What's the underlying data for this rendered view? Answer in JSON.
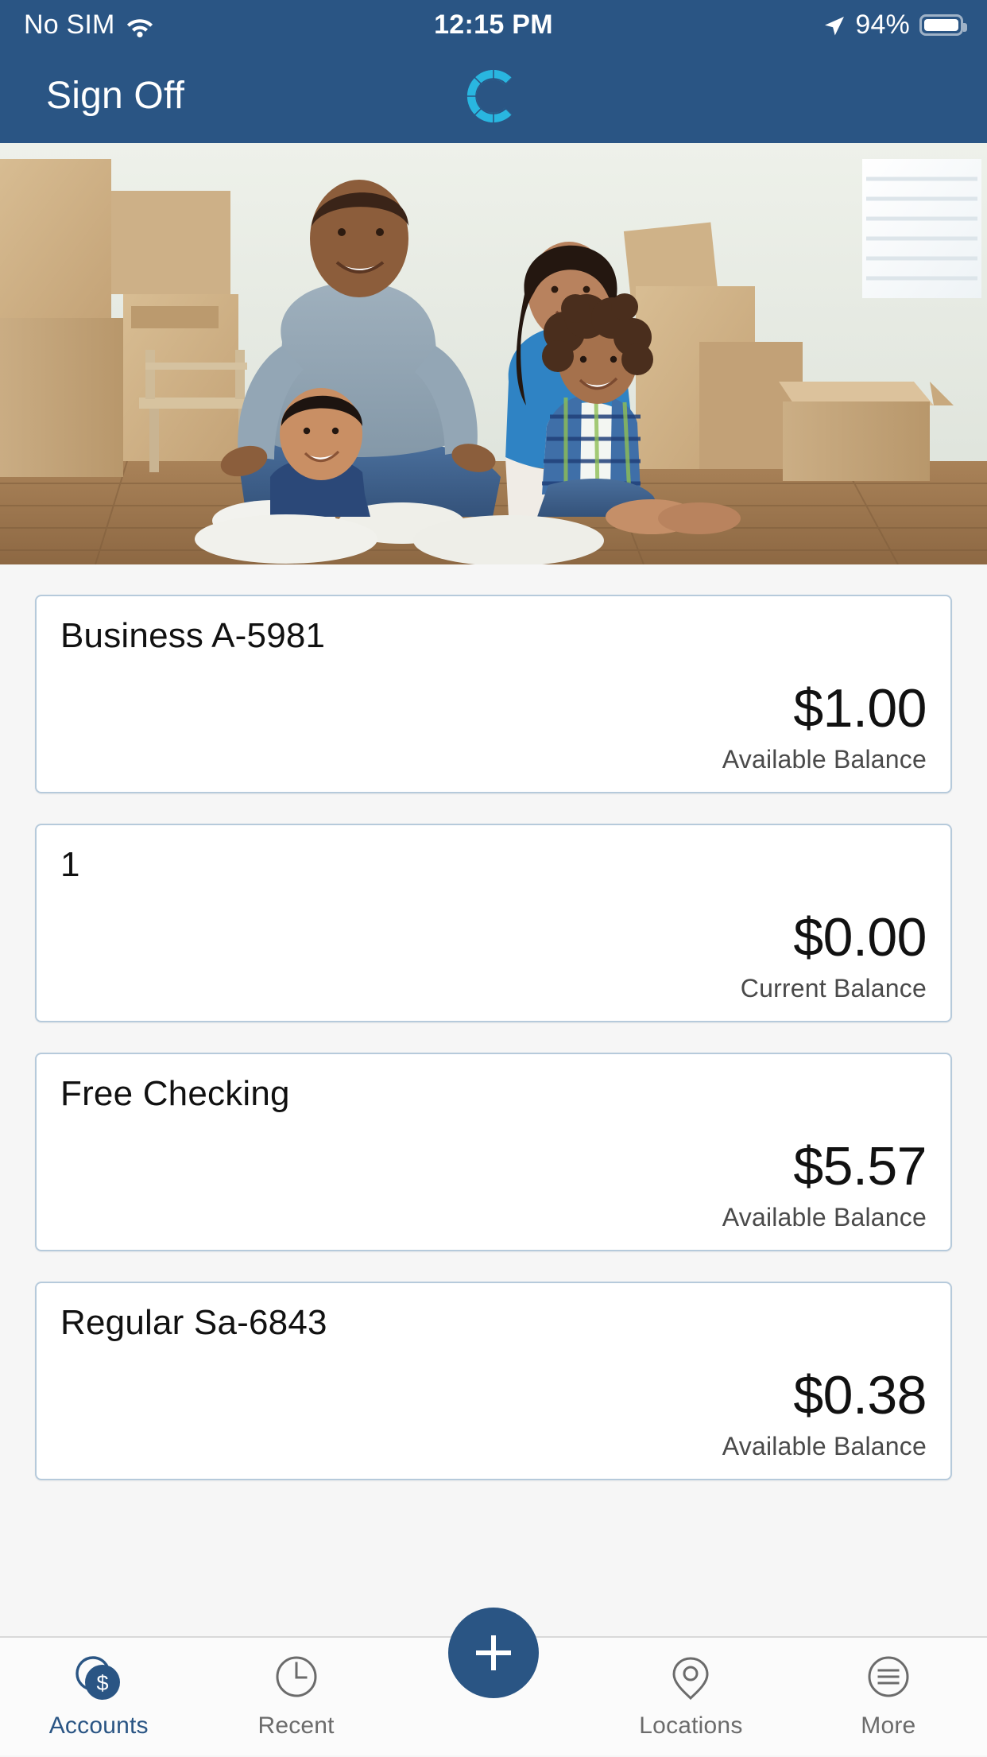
{
  "status_bar": {
    "carrier": "No SIM",
    "wifi_icon": "wifi-icon",
    "time": "12:15 PM",
    "location_icon": "location-arrow-icon",
    "battery_percent": "94%",
    "battery_icon": "battery-full-icon"
  },
  "nav_bar": {
    "sign_off_label": "Sign Off",
    "logo_icon": "bank-c-logo-icon"
  },
  "hero": {
    "alt": "Family with two children sitting on wood floor among cardboard moving boxes"
  },
  "accounts": [
    {
      "name": "Business A-5981",
      "amount": "$1.00",
      "balance_label": "Available Balance"
    },
    {
      "name": "1",
      "amount": "$0.00",
      "balance_label": "Current Balance"
    },
    {
      "name": "Free Checking",
      "amount": "$5.57",
      "balance_label": "Available Balance"
    },
    {
      "name": "Regular Sa-6843",
      "amount": "$0.38",
      "balance_label": "Available Balance"
    }
  ],
  "tab_bar": {
    "tabs": [
      {
        "label": "Accounts",
        "icon": "coins-dollar-icon",
        "active": true
      },
      {
        "label": "Recent",
        "icon": "clock-icon",
        "active": false
      },
      {
        "label": "Locations",
        "icon": "map-pin-icon",
        "active": false
      },
      {
        "label": "More",
        "icon": "menu-circle-icon",
        "active": false
      }
    ],
    "fab": {
      "label": "+",
      "icon": "plus-icon"
    }
  },
  "colors": {
    "header_navy": "#2a5584",
    "accent_cyan": "#29b6e0",
    "page_bg": "#f6f6f6",
    "card_border": "#b6cadb",
    "tab_inactive": "#6b6b6b"
  }
}
